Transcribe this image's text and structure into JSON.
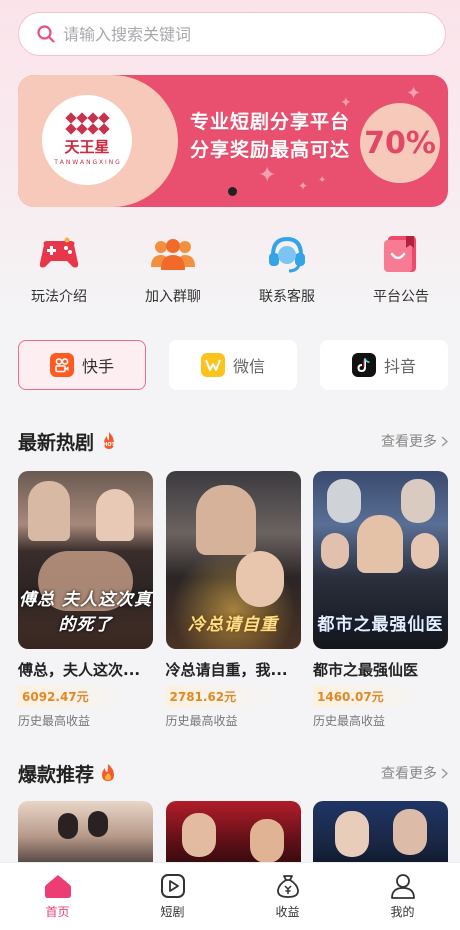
{
  "search": {
    "placeholder": "请输入搜索关键词"
  },
  "banner": {
    "logo_name": "天王星",
    "logo_sub": "T A N W A N G X I N G",
    "line1": "专业短剧分享平台",
    "line2": "分享奖励最高可达",
    "percent": "70%"
  },
  "quick": [
    {
      "label": "玩法介绍",
      "icon": "gamepad-icon"
    },
    {
      "label": "加入群聊",
      "icon": "group-icon"
    },
    {
      "label": "联系客服",
      "icon": "headset-icon"
    },
    {
      "label": "平台公告",
      "icon": "notice-book-icon"
    }
  ],
  "platforms": [
    {
      "label": "快手",
      "active": true
    },
    {
      "label": "微信",
      "active": false
    },
    {
      "label": "抖音",
      "active": false
    }
  ],
  "section1": {
    "title": "最新热剧",
    "badge": "HOT",
    "more": "查看更多"
  },
  "cards": [
    {
      "title": "傅总，夫人这次...",
      "poster_text": "傅总 夫人这次真的死了",
      "amount": "6092.47元",
      "hist": "历史最高收益"
    },
    {
      "title": "冷总请自重，我...",
      "poster_text": "冷总请自重",
      "amount": "2781.62元",
      "hist": "历史最高收益"
    },
    {
      "title": "都市之最强仙医",
      "poster_text": "都市之最强仙医",
      "amount": "1460.07元",
      "hist": "历史最高收益"
    }
  ],
  "section2": {
    "title": "爆款推荐",
    "more": "查看更多"
  },
  "tabs": [
    {
      "label": "首页",
      "icon": "home-icon",
      "active": true
    },
    {
      "label": "短剧",
      "icon": "play-icon",
      "active": false
    },
    {
      "label": "收益",
      "icon": "money-bag-icon",
      "active": false
    },
    {
      "label": "我的",
      "icon": "user-icon",
      "active": false
    }
  ],
  "colors": {
    "accent": "#ec3e74",
    "banner": "#e9506f",
    "amount": "#e0892a"
  }
}
